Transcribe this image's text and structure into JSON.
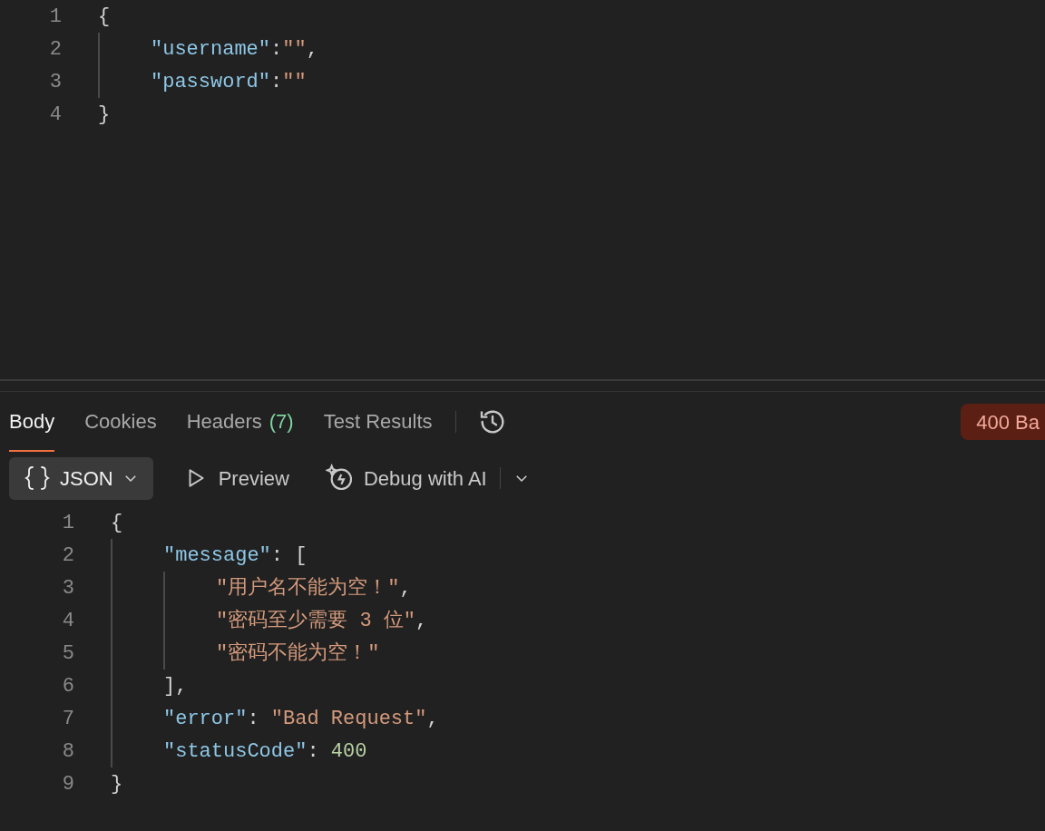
{
  "request_body": {
    "lines": [
      {
        "number": "1",
        "tokens": [
          {
            "kind": "punct",
            "text": "{"
          }
        ],
        "children": [
          {
            "number": "2",
            "tokens": [
              {
                "kind": "key",
                "text": "\"username\""
              },
              {
                "kind": "punct",
                "text": ":"
              },
              {
                "kind": "string",
                "text": "\"\""
              },
              {
                "kind": "punct",
                "text": ","
              }
            ]
          },
          {
            "number": "3",
            "tokens": [
              {
                "kind": "key",
                "text": "\"password\""
              },
              {
                "kind": "punct",
                "text": ":"
              },
              {
                "kind": "string",
                "text": "\"\""
              }
            ]
          }
        ]
      },
      {
        "number": "4",
        "tokens": [
          {
            "kind": "punct",
            "text": "}"
          }
        ]
      }
    ]
  },
  "response_tabs": [
    {
      "label": "Body",
      "selected": true
    },
    {
      "label": "Cookies",
      "selected": false
    },
    {
      "label": "Headers",
      "count": "(7)",
      "selected": false
    },
    {
      "label": "Test Results",
      "selected": false
    }
  ],
  "status_badge": "400 Ba",
  "toolbar": {
    "format": "JSON",
    "preview": "Preview",
    "debug": "Debug with AI"
  },
  "response_body": {
    "lines": [
      {
        "number": "1",
        "tokens": [
          {
            "kind": "punct",
            "text": "{"
          }
        ],
        "children": [
          {
            "number": "2",
            "tokens": [
              {
                "kind": "key",
                "text": "\"message\""
              },
              {
                "kind": "punct",
                "text": ": ["
              }
            ],
            "children": [
              {
                "number": "3",
                "tokens": [
                  {
                    "kind": "string",
                    "text": "\"用户名不能为空！\""
                  },
                  {
                    "kind": "punct",
                    "text": ","
                  }
                ]
              },
              {
                "number": "4",
                "tokens": [
                  {
                    "kind": "string",
                    "text": "\"密码至少需要 3 位\""
                  },
                  {
                    "kind": "punct",
                    "text": ","
                  }
                ]
              },
              {
                "number": "5",
                "tokens": [
                  {
                    "kind": "string",
                    "text": "\"密码不能为空！\""
                  }
                ]
              }
            ]
          },
          {
            "number": "6",
            "tokens": [
              {
                "kind": "punct",
                "text": "],"
              }
            ]
          },
          {
            "number": "7",
            "tokens": [
              {
                "kind": "key",
                "text": "\"error\""
              },
              {
                "kind": "punct",
                "text": ": "
              },
              {
                "kind": "string",
                "text": "\"Bad Request\""
              },
              {
                "kind": "punct",
                "text": ","
              }
            ]
          },
          {
            "number": "8",
            "tokens": [
              {
                "kind": "key",
                "text": "\"statusCode\""
              },
              {
                "kind": "punct",
                "text": ": "
              },
              {
                "kind": "number",
                "text": "400"
              }
            ]
          }
        ]
      },
      {
        "number": "9",
        "tokens": [
          {
            "kind": "punct",
            "text": "}"
          }
        ]
      }
    ]
  }
}
